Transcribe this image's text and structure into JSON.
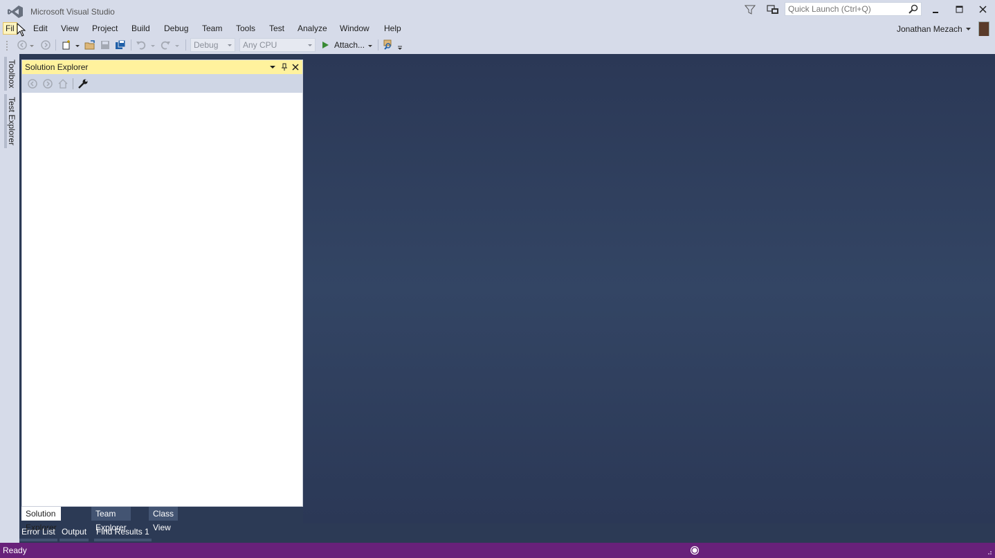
{
  "window": {
    "title": "Microsoft Visual Studio"
  },
  "quick_launch": {
    "placeholder": "Quick Launch (Ctrl+Q)"
  },
  "menu": {
    "items": [
      "File",
      "Edit",
      "View",
      "Project",
      "Build",
      "Debug",
      "Team",
      "Tools",
      "Test",
      "Analyze",
      "Window",
      "Help"
    ],
    "file_visible": "Fil"
  },
  "user": {
    "name": "Jonathan Mezach"
  },
  "toolbar": {
    "config": "Debug",
    "platform": "Any CPU",
    "attach_label": "Attach..."
  },
  "left_rail": {
    "tabs": [
      "Toolbox",
      "Test Explorer"
    ]
  },
  "solution_explorer": {
    "title": "Solution Explorer",
    "tabs": [
      "Solution Explorer",
      "Team Explorer",
      "Class View"
    ]
  },
  "bottom_tabs": [
    "Error List",
    "Output",
    "Find Results 1"
  ],
  "status": {
    "text": "Ready"
  },
  "colors": {
    "accent_status": "#68217a",
    "panel_title": "#fff29d",
    "chrome": "#d6dbe9"
  }
}
